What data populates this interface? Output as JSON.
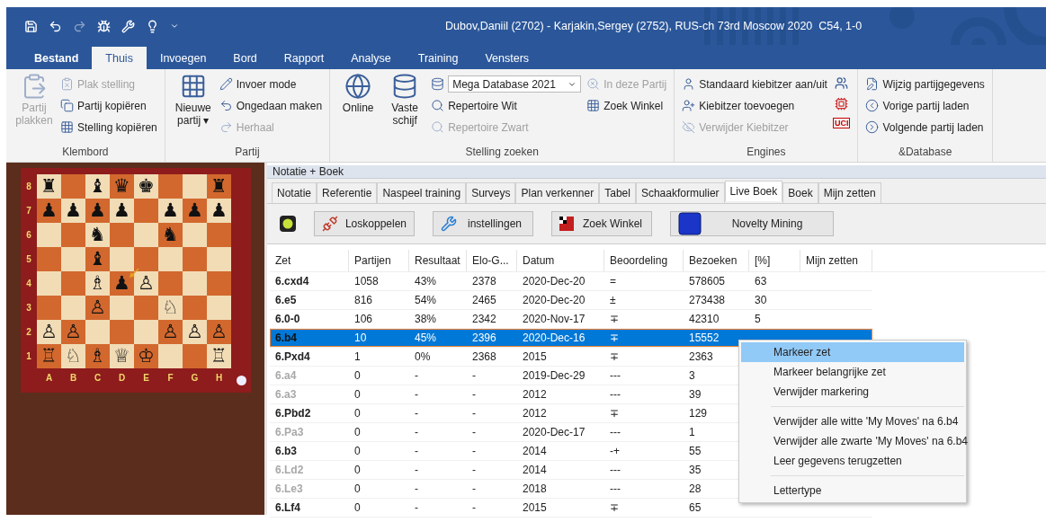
{
  "title_bar": {
    "title": "Dubov,Daniil (2702) - Karjakin,Sergey (2752), RUS-ch 73rd Moscow 2020  C54, 1-0"
  },
  "quick_access": [
    {
      "disabled": false
    },
    {
      "disabled": false
    },
    {
      "disabled": true
    },
    {
      "disabled": false
    },
    {
      "disabled": false
    },
    {
      "disabled": false
    },
    {
      "disabled": false
    }
  ],
  "ribbon_tabs": [
    {
      "label": "Bestand",
      "kind": "file",
      "selected": false
    },
    {
      "label": "Thuis",
      "kind": "tab",
      "selected": true
    },
    {
      "label": "Invoegen",
      "kind": "tab",
      "selected": false
    },
    {
      "label": "Bord",
      "kind": "tab",
      "selected": false
    },
    {
      "label": "Rapport",
      "kind": "tab",
      "selected": false
    },
    {
      "label": "Analyse",
      "kind": "tab",
      "selected": false
    },
    {
      "label": "Training",
      "kind": "tab",
      "selected": false
    },
    {
      "label": "Vensters",
      "kind": "tab",
      "selected": false
    }
  ],
  "ribbon_groups": [
    {
      "label": "Klembord",
      "columns": [
        {
          "kind": "large",
          "items": [
            {
              "label": "Partij plakken",
              "disabled": true
            }
          ]
        },
        {
          "kind": "small",
          "items": [
            {
              "label": "Plak stelling",
              "disabled": true
            },
            {
              "label": "Partij kopiëren",
              "disabled": false
            },
            {
              "label": "Stelling kopiëren",
              "disabled": false
            }
          ]
        }
      ]
    },
    {
      "label": "Partij",
      "columns": [
        {
          "kind": "large",
          "items": [
            {
              "label": "Nieuwe partij",
              "disabled": false,
              "caret": "▾"
            }
          ]
        },
        {
          "kind": "small",
          "items": [
            {
              "label": "Invoer mode",
              "disabled": false
            },
            {
              "label": "Ongedaan maken",
              "disabled": false
            },
            {
              "label": "Herhaal",
              "disabled": true
            }
          ]
        }
      ]
    },
    {
      "label": "Stelling zoeken",
      "columns": [
        {
          "kind": "large",
          "items": [
            {
              "label": "Online",
              "disabled": false
            }
          ]
        },
        {
          "kind": "large",
          "items": [
            {
              "label": "Vaste schijf",
              "disabled": false
            }
          ]
        },
        {
          "kind": "small",
          "items": [
            {
              "label": "Mega Database 2021",
              "kind": "select",
              "disabled": false
            },
            {
              "label": "Repertoire Wit",
              "disabled": false
            },
            {
              "label": "Repertoire Zwart",
              "disabled": true
            }
          ]
        },
        {
          "kind": "small",
          "items": [
            {
              "label": "In deze Partij",
              "disabled": true
            },
            {
              "label": "Zoek Winkel",
              "disabled": false
            }
          ]
        }
      ]
    },
    {
      "label": "Engines",
      "tag": "UCI",
      "columns": [
        {
          "kind": "small",
          "items": [
            {
              "label": "Standaard kiebitzer aan/uit",
              "disabled": false
            },
            {
              "label": "Kiebitzer toevoegen",
              "disabled": false
            },
            {
              "label": "Verwijder Kiebitzer",
              "disabled": true
            }
          ]
        }
      ]
    },
    {
      "label": "&Database",
      "columns": [
        {
          "kind": "small",
          "items": [
            {
              "label": "Wijzig partijgegevens",
              "disabled": false
            },
            {
              "label": "Vorige partij laden",
              "disabled": false
            },
            {
              "label": "Volgende partij laden",
              "disabled": false
            }
          ]
        }
      ]
    }
  ],
  "board": {
    "ranks": [
      {
        "label": "8",
        "squares": [
          {
            "kind": "piece",
            "piece": "♜"
          },
          {
            "kind": "empty"
          },
          {
            "kind": "piece",
            "piece": "♝"
          },
          {
            "kind": "piece",
            "piece": "♛"
          },
          {
            "kind": "piece",
            "piece": "♚"
          },
          {
            "kind": "empty"
          },
          {
            "kind": "empty"
          },
          {
            "kind": "piece",
            "piece": "♜"
          }
        ]
      },
      {
        "label": "7",
        "squares": [
          {
            "kind": "piece",
            "piece": "♟"
          },
          {
            "kind": "piece",
            "piece": "♟"
          },
          {
            "kind": "piece",
            "piece": "♟"
          },
          {
            "kind": "piece",
            "piece": "♟"
          },
          {
            "kind": "empty"
          },
          {
            "kind": "piece",
            "piece": "♟"
          },
          {
            "kind": "piece",
            "piece": "♟"
          },
          {
            "kind": "piece",
            "piece": "♟"
          }
        ]
      },
      {
        "label": "6",
        "squares": [
          {
            "kind": "empty"
          },
          {
            "kind": "empty"
          },
          {
            "kind": "piece",
            "piece": "♞"
          },
          {
            "kind": "empty"
          },
          {
            "kind": "empty"
          },
          {
            "kind": "piece",
            "piece": "♞"
          },
          {
            "kind": "empty"
          },
          {
            "kind": "empty"
          }
        ]
      },
      {
        "label": "5",
        "squares": [
          {
            "kind": "empty"
          },
          {
            "kind": "empty"
          },
          {
            "kind": "piece",
            "piece": "♝"
          },
          {
            "kind": "empty"
          },
          {
            "kind": "empty"
          },
          {
            "kind": "empty"
          },
          {
            "kind": "empty"
          },
          {
            "kind": "empty"
          }
        ]
      },
      {
        "label": "4",
        "squares": [
          {
            "kind": "empty"
          },
          {
            "kind": "empty"
          },
          {
            "kind": "piece",
            "piece": "♗"
          },
          {
            "kind": "piece",
            "piece": "♟"
          },
          {
            "kind": "piece",
            "piece": "♙"
          },
          {
            "kind": "empty"
          },
          {
            "kind": "empty"
          },
          {
            "kind": "empty"
          }
        ]
      },
      {
        "label": "3",
        "squares": [
          {
            "kind": "empty"
          },
          {
            "kind": "empty"
          },
          {
            "kind": "piece",
            "piece": "♙"
          },
          {
            "kind": "empty"
          },
          {
            "kind": "empty"
          },
          {
            "kind": "piece",
            "piece": "♘"
          },
          {
            "kind": "empty"
          },
          {
            "kind": "empty"
          }
        ]
      },
      {
        "label": "2",
        "squares": [
          {
            "kind": "piece",
            "piece": "♙"
          },
          {
            "kind": "piece",
            "piece": "♙"
          },
          {
            "kind": "empty"
          },
          {
            "kind": "empty"
          },
          {
            "kind": "empty"
          },
          {
            "kind": "piece",
            "piece": "♙"
          },
          {
            "kind": "piece",
            "piece": "♙"
          },
          {
            "kind": "piece",
            "piece": "♙"
          }
        ]
      },
      {
        "label": "1",
        "squares": [
          {
            "kind": "piece",
            "piece": "♖"
          },
          {
            "kind": "piece",
            "piece": "♘"
          },
          {
            "kind": "piece",
            "piece": "♗"
          },
          {
            "kind": "piece",
            "piece": "♕"
          },
          {
            "kind": "piece",
            "piece": "♔"
          },
          {
            "kind": "empty"
          },
          {
            "kind": "empty"
          },
          {
            "kind": "piece",
            "piece": "♖"
          }
        ]
      }
    ],
    "files": [
      "A",
      "B",
      "C",
      "D",
      "E",
      "F",
      "G",
      "H"
    ]
  },
  "panel": {
    "title": "Notatie + Boek",
    "tabs": [
      {
        "label": "Notatie",
        "selected": false
      },
      {
        "label": "Referentie",
        "selected": false
      },
      {
        "label": "Naspeel training",
        "selected": false
      },
      {
        "label": "Surveys",
        "selected": false
      },
      {
        "label": "Plan verkenner",
        "selected": false
      },
      {
        "label": "Tabel",
        "selected": false
      },
      {
        "label": "Schaakformulier",
        "selected": false
      },
      {
        "label": "Live Boek",
        "selected": true
      },
      {
        "label": "Boek",
        "selected": false
      },
      {
        "label": "Mijn zetten",
        "selected": false
      }
    ],
    "toolbar": [
      "Loskoppelen",
      "instellingen",
      "Zoek Winkel",
      "Novelty Mining"
    ],
    "table": {
      "columns": [
        "Zet",
        "Partijen",
        "Resultaat",
        "Elo-G...",
        "Datum",
        "Beoordeling",
        "Bezoeken",
        "[%]",
        "Mijn zetten"
      ],
      "rows": [
        {
          "cells": [
            "6.cxd4",
            "1058",
            "43%",
            "2378",
            "2020-Dec-20",
            "=",
            "578605",
            "63"
          ],
          "dimmed": false,
          "selected": false
        },
        {
          "cells": [
            "6.e5",
            "816",
            "54%",
            "2465",
            "2020-Dec-20",
            "±",
            "273438",
            "30"
          ],
          "dimmed": false,
          "selected": false
        },
        {
          "cells": [
            "6.0-0",
            "106",
            "38%",
            "2342",
            "2020-Nov-17",
            "∓",
            "42310",
            "5"
          ],
          "dimmed": false,
          "selected": false
        },
        {
          "cells": [
            "6.b4",
            "10",
            "45%",
            "2396",
            "2020-Dec-16",
            "∓",
            "15552"
          ],
          "dimmed": false,
          "selected": true
        },
        {
          "cells": [
            "6.Pxd4",
            "1",
            "0%",
            "2368",
            "2015",
            "∓",
            "2363"
          ],
          "dimmed": false,
          "selected": false
        },
        {
          "cells": [
            "6.a4",
            "0",
            "-",
            "-",
            "2019-Dec-29",
            "---",
            "3"
          ],
          "dimmed": true,
          "selected": false
        },
        {
          "cells": [
            "6.a3",
            "0",
            "-",
            "-",
            "2012",
            "---",
            "39"
          ],
          "dimmed": true,
          "selected": false
        },
        {
          "cells": [
            "6.Pbd2",
            "0",
            "-",
            "-",
            "2012",
            "∓",
            "129"
          ],
          "dimmed": false,
          "selected": false
        },
        {
          "cells": [
            "6.Pa3",
            "0",
            "-",
            "-",
            "2020-Dec-17",
            "---",
            "1"
          ],
          "dimmed": true,
          "selected": false
        },
        {
          "cells": [
            "6.b3",
            "0",
            "-",
            "-",
            "2014",
            "-+",
            "55"
          ],
          "dimmed": false,
          "selected": false
        },
        {
          "cells": [
            "6.Ld2",
            "0",
            "-",
            "-",
            "2014",
            "---",
            "35"
          ],
          "dimmed": true,
          "selected": false
        },
        {
          "cells": [
            "6.Le3",
            "0",
            "-",
            "-",
            "2018",
            "---",
            "28"
          ],
          "dimmed": true,
          "selected": false
        },
        {
          "cells": [
            "6.Lf4",
            "0",
            "-",
            "-",
            "2015",
            "∓",
            "65"
          ],
          "dimmed": false,
          "selected": false
        }
      ]
    }
  },
  "context_menu": {
    "items": [
      {
        "kind": "item",
        "label": "Markeer zet",
        "selected": true
      },
      {
        "kind": "item",
        "label": "Markeer belangrijke zet",
        "selected": false
      },
      {
        "kind": "item",
        "label": "Verwijder markering",
        "selected": false
      },
      {
        "kind": "separator"
      },
      {
        "kind": "item",
        "label": "Verwijder alle witte 'My Moves' na 6.b4",
        "selected": false
      },
      {
        "kind": "item",
        "label": "Verwijder alle zwarte 'My Moves' na 6.b4",
        "selected": false
      },
      {
        "kind": "item",
        "label": "Leer gegevens terugzetten",
        "selected": false
      },
      {
        "kind": "separator"
      },
      {
        "kind": "item",
        "label": "Lettertype",
        "selected": false
      }
    ]
  }
}
